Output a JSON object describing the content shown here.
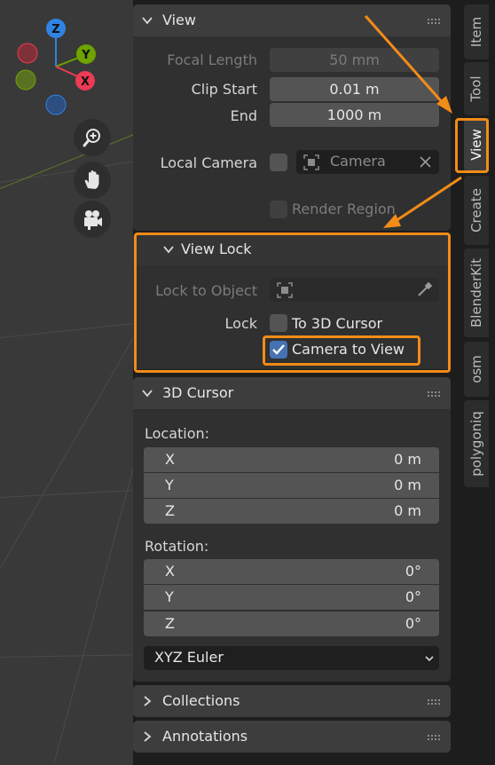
{
  "colors": {
    "accent_orange": "#f28c19",
    "checkbox_blue": "#4772b3",
    "axis_x": "#ec3b54",
    "axis_y": "#6ea300",
    "axis_z": "#2f83e3"
  },
  "gizmo": {
    "z": "Z",
    "y": "Y",
    "x": "X"
  },
  "nav_icons": [
    "zoom-icon",
    "hand-pan-icon",
    "camera-icon"
  ],
  "view_panel": {
    "title": "View",
    "focal_length_label": "Focal Length",
    "focal_length_value": "50 mm",
    "clip_start_label": "Clip Start",
    "clip_start_value": "0.01 m",
    "end_label": "End",
    "end_value": "1000 m",
    "local_camera_label": "Local Camera",
    "local_camera_placeholder": "Camera",
    "render_region_label": "Render Region"
  },
  "view_lock": {
    "title": "View Lock",
    "lock_to_object_label": "Lock to Object",
    "lock_label": "Lock",
    "to_3d_cursor_label": "To 3D Cursor",
    "camera_to_view_label": "Camera to View",
    "camera_to_view_checked": true
  },
  "cursor_panel": {
    "title": "3D Cursor",
    "location_label": "Location:",
    "location": [
      {
        "axis": "X",
        "value": "0 m"
      },
      {
        "axis": "Y",
        "value": "0 m"
      },
      {
        "axis": "Z",
        "value": "0 m"
      }
    ],
    "rotation_label": "Rotation:",
    "rotation": [
      {
        "axis": "X",
        "value": "0°"
      },
      {
        "axis": "Y",
        "value": "0°"
      },
      {
        "axis": "Z",
        "value": "0°"
      }
    ],
    "rotation_mode": "XYZ Euler"
  },
  "collections_panel": {
    "title": "Collections"
  },
  "annotations_panel": {
    "title": "Annotations"
  },
  "tabs": [
    {
      "label": "Item",
      "active": false
    },
    {
      "label": "Tool",
      "active": false
    },
    {
      "label": "View",
      "active": true
    },
    {
      "label": "Create",
      "active": false
    },
    {
      "label": "BlenderKit",
      "active": false
    },
    {
      "label": "osm",
      "active": false
    },
    {
      "label": "polygoniq",
      "active": false
    }
  ]
}
